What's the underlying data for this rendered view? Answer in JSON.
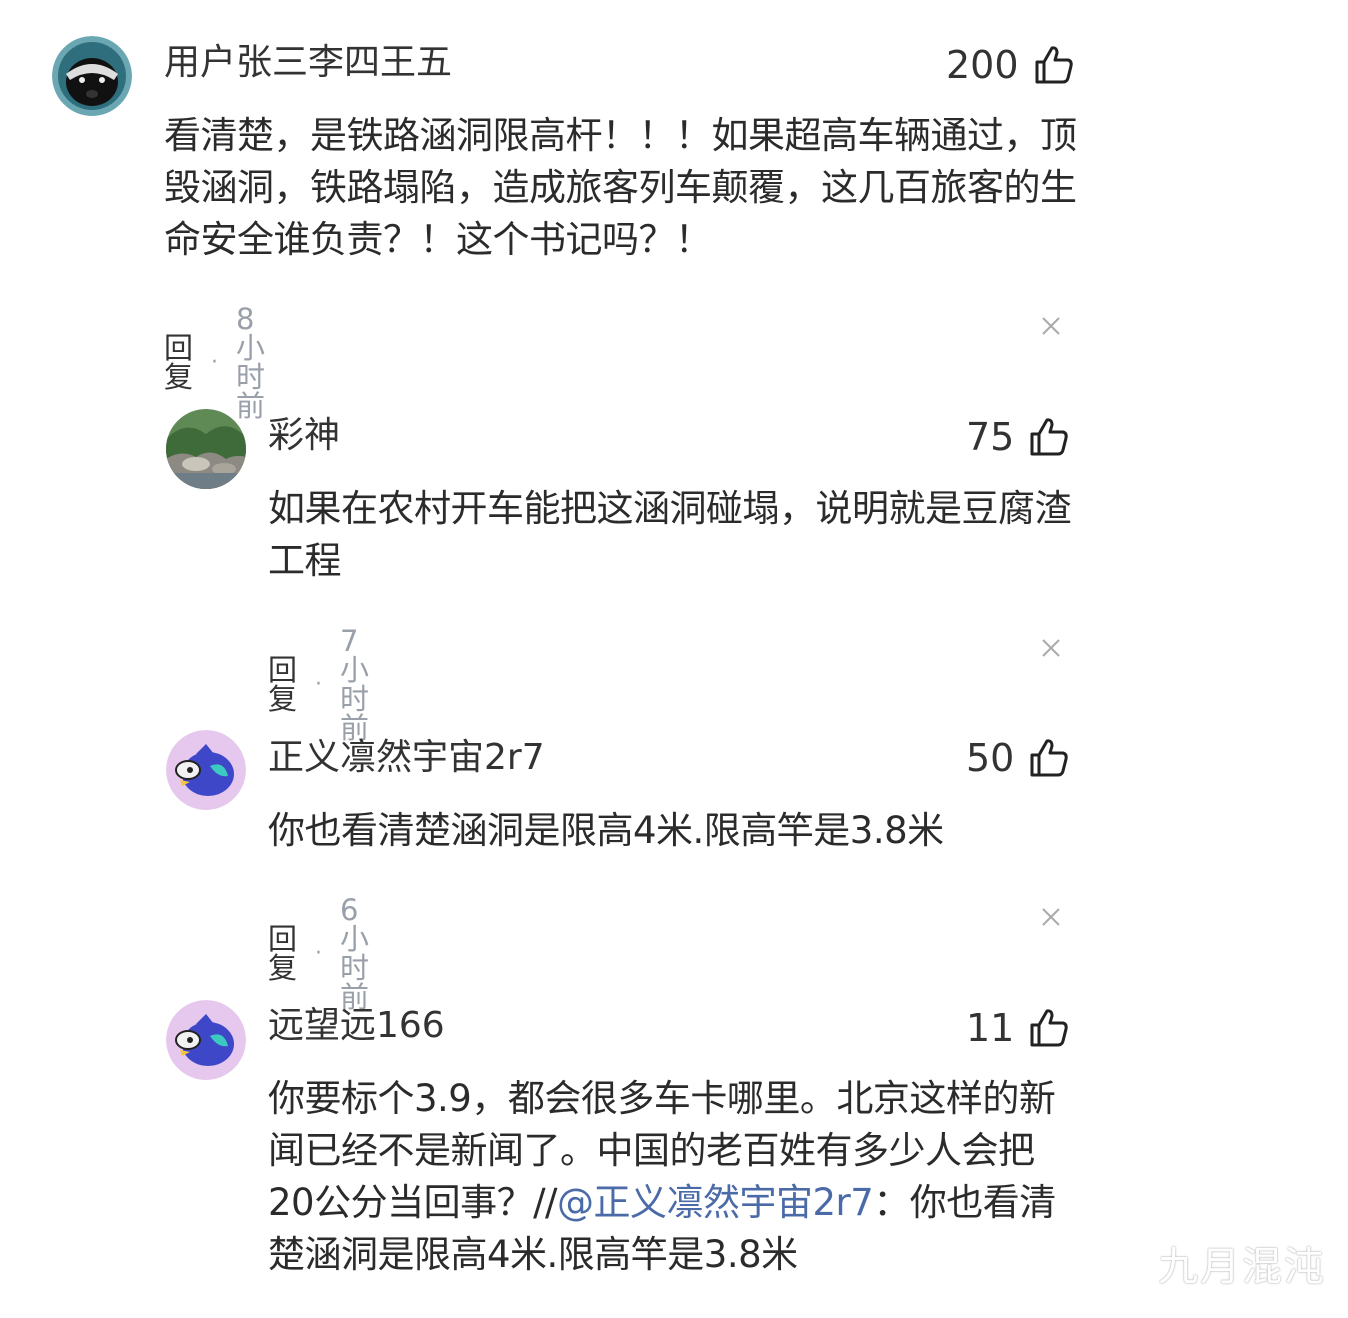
{
  "comments": [
    {
      "username": "用户张三李四王五",
      "likes": "200",
      "content": "看清楚，是铁路涵洞限高杆！！！如果超高车辆通过，顶毁涵洞，铁路塌陷，造成旅客列车颠覆，这几百旅客的生命安全谁负责？！这个书记吗？！",
      "reply_label": "回复",
      "time": "8小时前",
      "avatar_icon": "badger-avatar"
    },
    {
      "username": "彩神",
      "likes": "75",
      "content": "如果在农村开车能把这涵洞碰塌，说明就是豆腐渣工程",
      "reply_label": "回复",
      "time": "7小时前",
      "avatar_icon": "landscape-avatar"
    },
    {
      "username": "正义凛然宇宙2r7",
      "likes": "50",
      "content": "你也看清楚涵洞是限高4米.限高竿是3.8米",
      "reply_label": "回复",
      "time": "6小时前",
      "avatar_icon": "bird-avatar"
    },
    {
      "username": "远望远166",
      "likes": "11",
      "content_before": "你要标个3.9，都会很多车卡哪里。北京这样的新闻已经不是新闻了。中国的老百姓有多少人会把20公分当回事？//",
      "mention": "@正义凛然宇宙2r7",
      "content_after": "：你也看清楚涵洞是限高4米.限高竿是3.8米",
      "avatar_icon": "bird-avatar"
    }
  ],
  "watermark": "九月混沌",
  "colors": {
    "text": "#2b2b2b",
    "muted": "#9aa0aa",
    "mention": "#4b6aa8"
  }
}
